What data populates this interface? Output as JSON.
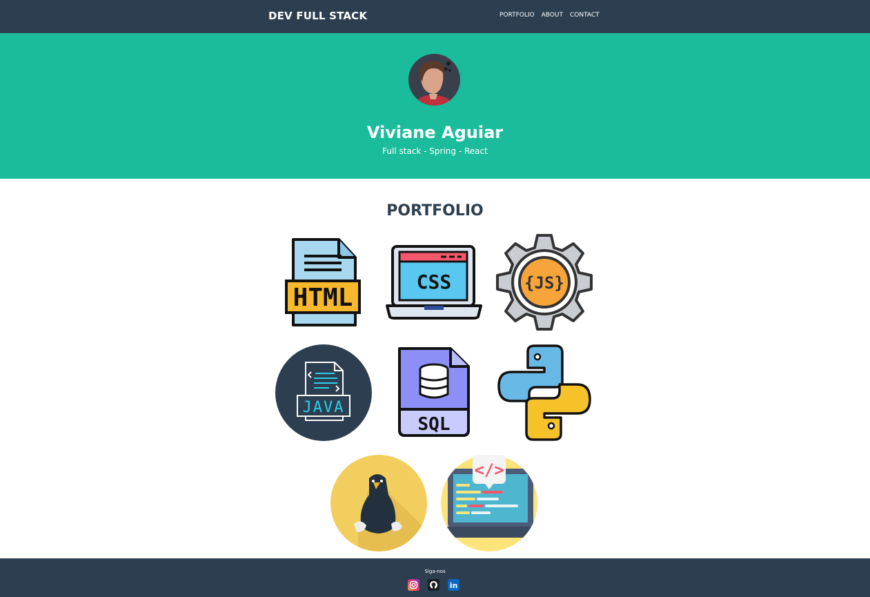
{
  "header": {
    "brand": "DEV FULL STACK",
    "menu": [
      "PORTFOLIO",
      "ABOUT",
      "CONTACT"
    ]
  },
  "hero": {
    "name": "Viviane Aguiar",
    "subtitle": "Full stack - Spring - React"
  },
  "portfolio": {
    "title": "PORTFOLIO",
    "items": [
      {
        "label": "HTML",
        "icon": "html-file-icon"
      },
      {
        "label": "CSS",
        "icon": "css-laptop-icon"
      },
      {
        "label": "{JS}",
        "icon": "js-gear-icon"
      },
      {
        "label": "JAVA",
        "icon": "java-file-icon"
      },
      {
        "label": "SQL",
        "icon": "sql-file-icon"
      },
      {
        "label": "",
        "icon": "python-logo-icon"
      },
      {
        "label": "",
        "icon": "linux-penguin-icon"
      },
      {
        "label": "</>",
        "icon": "code-laptop-icon"
      }
    ]
  },
  "footer": {
    "label": "Siga-nos",
    "social": [
      "instagram-icon",
      "github-icon",
      "linkedin-icon"
    ],
    "linkedin_text": "in"
  },
  "colors": {
    "navbar": "#2c3e50",
    "hero": "#1abc9c",
    "title": "#2c3e50"
  }
}
